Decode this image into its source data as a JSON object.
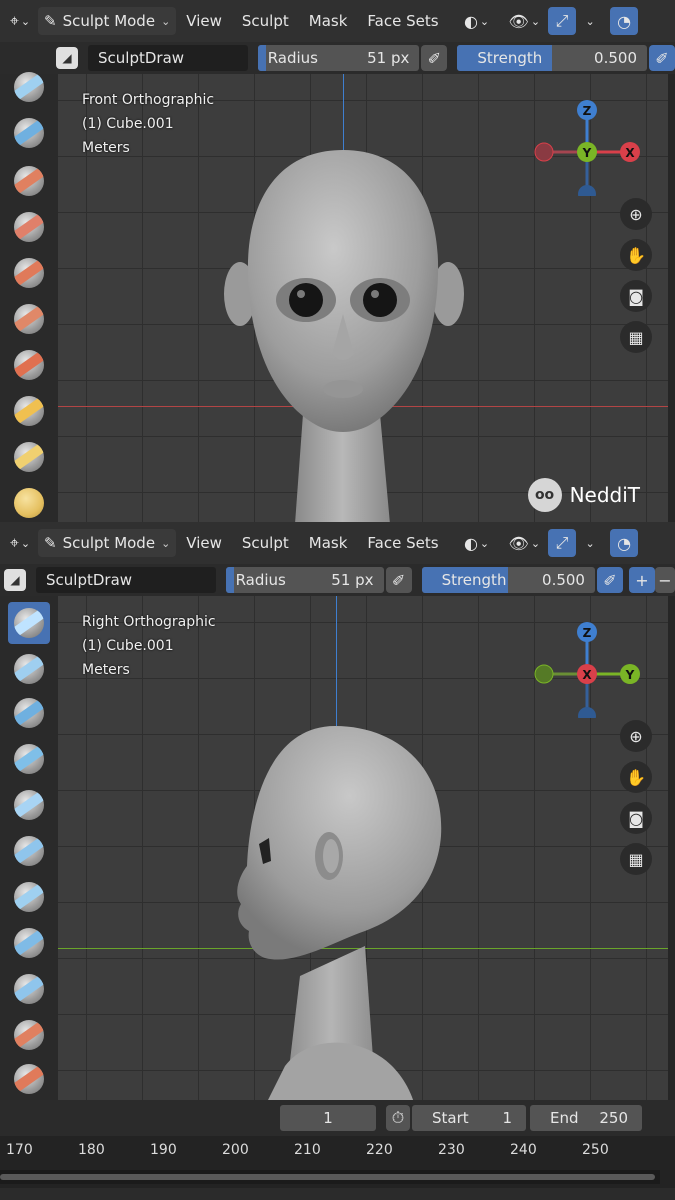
{
  "header": {
    "mode": "Sculpt Mode",
    "menus": [
      "View",
      "Sculpt",
      "Mask",
      "Face Sets"
    ]
  },
  "tool_settings": {
    "brush": "SculptDraw",
    "radius_label": "Radius",
    "radius_value": "51 px",
    "strength_label": "Strength",
    "strength_value": "0.500",
    "strength_fraction": 0.5
  },
  "viewports": [
    {
      "view": "Front Orthographic",
      "object": "(1) Cube.001",
      "units": "Meters",
      "gizmo": {
        "top": "Z",
        "center": "Y",
        "right": "X"
      }
    },
    {
      "view": "Right Orthographic",
      "object": "(1) Cube.001",
      "units": "Meters",
      "gizmo": {
        "top": "Z",
        "center": "X",
        "right": "Y"
      }
    }
  ],
  "watermark": {
    "text": "NeddiT",
    "badge": "oo"
  },
  "timeline": {
    "current_frame": "1",
    "start_label": "Start",
    "start_value": "1",
    "end_label": "End",
    "end_value": "250",
    "ruler": [
      "170",
      "180",
      "190",
      "200",
      "210",
      "220",
      "230",
      "240",
      "250"
    ]
  },
  "colors": {
    "accent": "#4772b3",
    "axis_x": "#d9404a",
    "axis_y": "#7ab526",
    "axis_z": "#3f7fd0"
  }
}
